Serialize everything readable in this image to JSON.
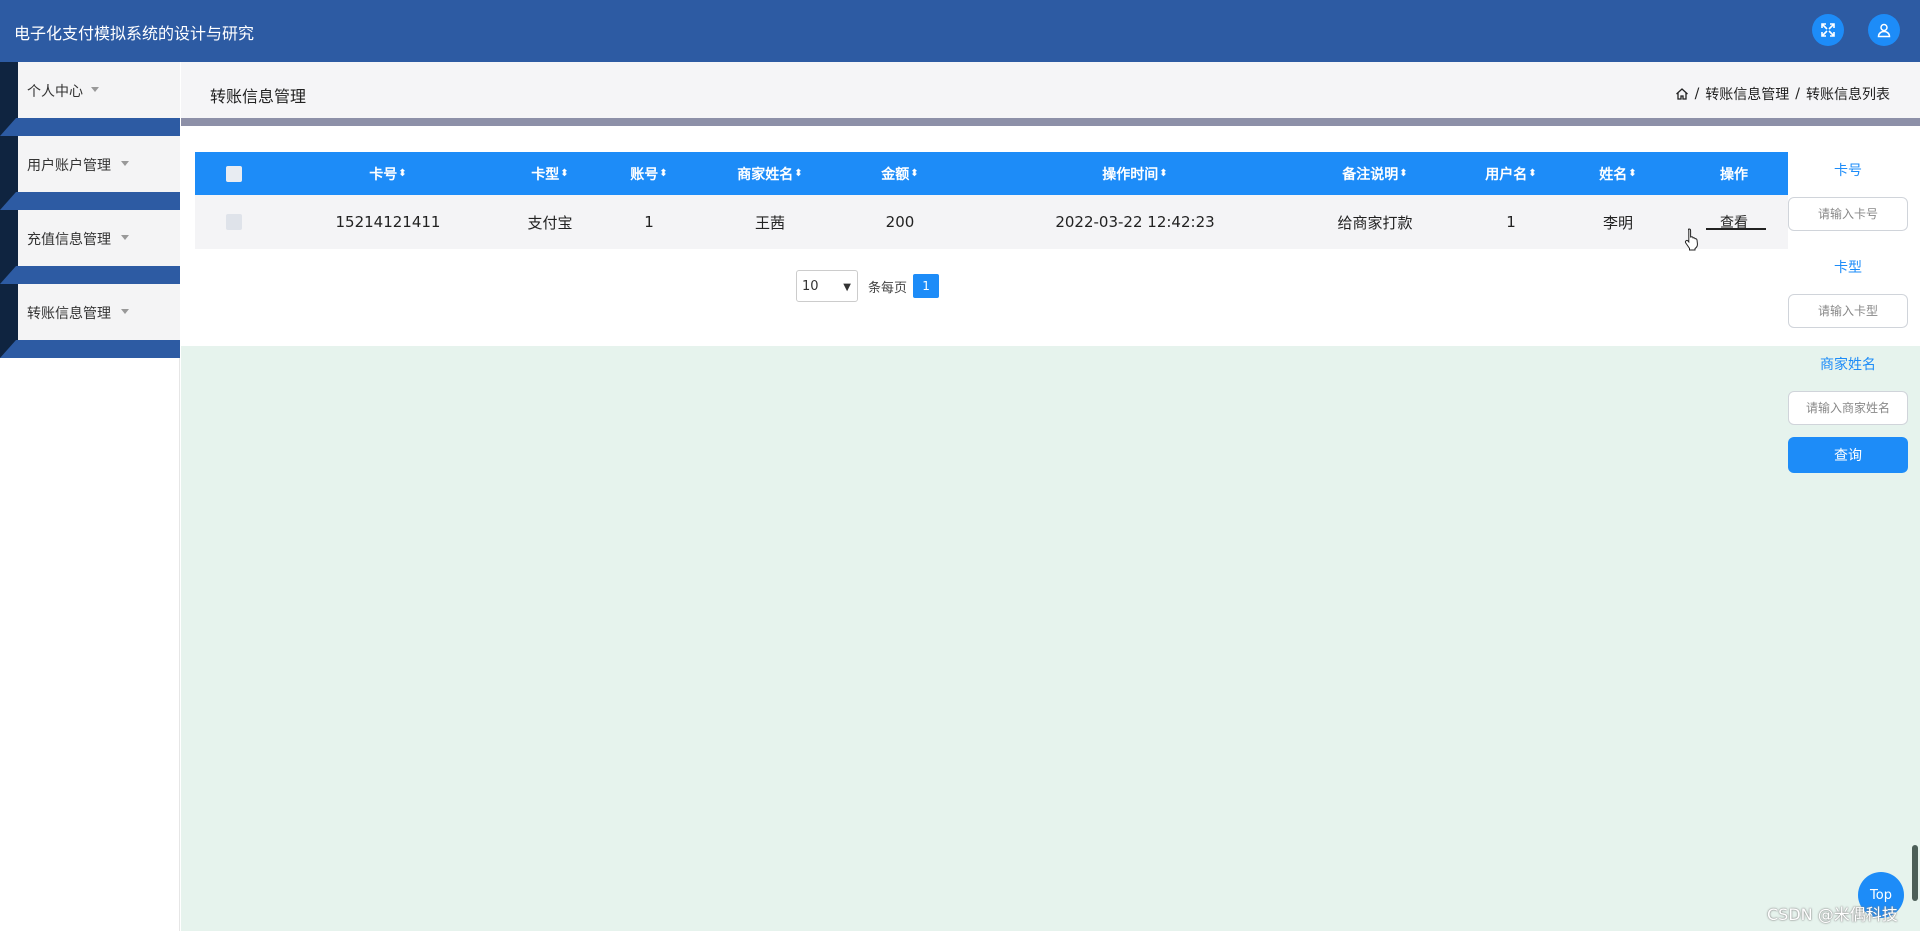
{
  "app": {
    "title": "电子化支付模拟系统的设计与研究"
  },
  "header_icons": {
    "fullscreen": "expand-icon",
    "user": "user-icon"
  },
  "sidebar": {
    "items": [
      {
        "label": "个人中心"
      },
      {
        "label": "用户账户管理"
      },
      {
        "label": "充值信息管理"
      },
      {
        "label": "转账信息管理"
      }
    ]
  },
  "page": {
    "title": "转账信息管理",
    "breadcrumb": [
      "转账信息管理",
      "转账信息列表"
    ],
    "breadcrumb_sep": "/"
  },
  "table": {
    "columns": [
      "卡号",
      "卡型",
      "账号",
      "商家姓名",
      "金额",
      "操作时间",
      "备注说明",
      "用户名",
      "姓名",
      "操作"
    ],
    "sort_glyph": "⬍",
    "rows": [
      {
        "card_no": "15214121411",
        "card_type": "支付宝",
        "account": "1",
        "merchant": "王茜",
        "amount": "200",
        "time": "2022-03-22 12:42:23",
        "remark": "给商家打款",
        "username": "1",
        "name": "李明",
        "action": "查看"
      }
    ]
  },
  "pagination": {
    "page_size": "10",
    "per_page_label": "条每页",
    "current_page": "1"
  },
  "search": {
    "fields": [
      {
        "label": "卡号",
        "placeholder": "请输入卡号"
      },
      {
        "label": "卡型",
        "placeholder": "请输入卡型"
      },
      {
        "label": "商家姓名",
        "placeholder": "请输入商家姓名"
      }
    ],
    "button": "查询"
  },
  "back_to_top": "Top",
  "watermark": "CSDN @米偶科技",
  "colors": {
    "primary": "#1d8cf8",
    "topbar": "#2d5ba3",
    "content_bg": "#e6f3ed"
  }
}
